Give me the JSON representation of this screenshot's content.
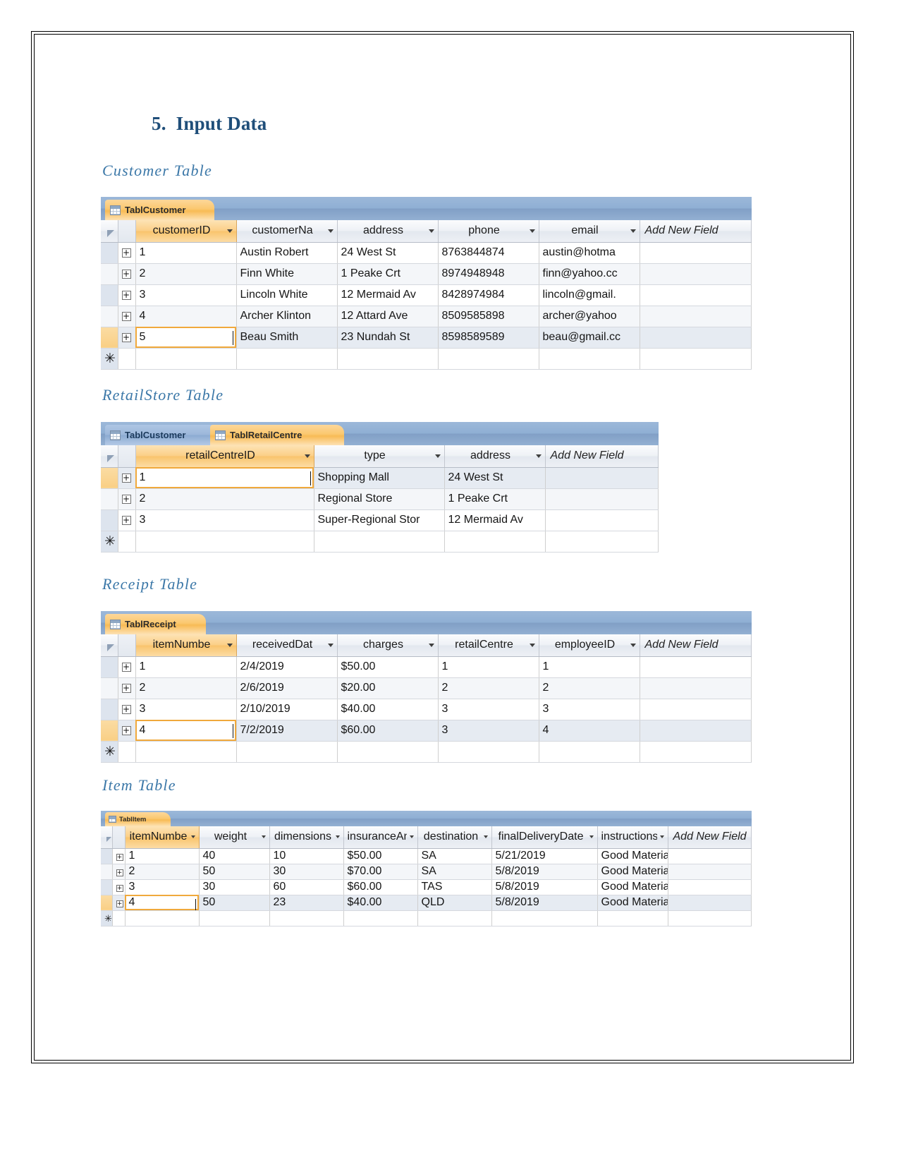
{
  "document": {
    "section_number": "5.",
    "section_title": "Input Data"
  },
  "sections": [
    {
      "key": "customer",
      "heading": "Customer Table"
    },
    {
      "key": "retailstore",
      "heading": "RetailStore Table"
    },
    {
      "key": "receipt",
      "heading": "Receipt Table"
    },
    {
      "key": "item",
      "heading": "Item Table"
    }
  ],
  "colors": {
    "heading": "#1f4e79",
    "subheading": "#3c78a8",
    "tab_active": "#f9c46d",
    "tab_inactive": "#9cb7da",
    "tabstrip": "#8fafd4",
    "selection_outline": "#f0a93c"
  },
  "add_new_field_label": "Add New Field",
  "new_record_marker": "✳",
  "expander_glyph": "+",
  "customer_table": {
    "tabs": [
      {
        "label": "TablCustomer",
        "active": true,
        "icon": "table-icon"
      }
    ],
    "columns": [
      "customerID",
      "customerNa",
      "address",
      "phone",
      "email"
    ],
    "active_column_index": 0,
    "rows": [
      {
        "cells": [
          "1",
          "Austin Robert",
          "24 West St",
          "8763844874",
          "austin@hotma"
        ]
      },
      {
        "cells": [
          "2",
          "Finn White",
          "1 Peake Crt",
          "8974948948",
          "finn@yahoo.cc"
        ]
      },
      {
        "cells": [
          "3",
          "Lincoln White",
          "12 Mermaid Av",
          "8428974984",
          "lincoln@gmail."
        ]
      },
      {
        "cells": [
          "4",
          "Archer Klinton",
          "12 Attard Ave",
          "8509585898",
          "archer@yahoo"
        ]
      },
      {
        "cells": [
          "5",
          "Beau Smith",
          "23 Nundah St",
          "8598589589",
          "beau@gmail.cc"
        ]
      }
    ],
    "selected_row_index": 4,
    "selected_cell_column": 0
  },
  "retailstore_table": {
    "tabs": [
      {
        "label": "TablCustomer",
        "active": false,
        "icon": "table-icon"
      },
      {
        "label": "TablRetailCentre",
        "active": true,
        "icon": "table-icon"
      }
    ],
    "columns": [
      "retailCentreID",
      "type",
      "address"
    ],
    "active_column_index": 0,
    "rows": [
      {
        "cells": [
          "1",
          "Shopping Mall",
          "24 West St"
        ]
      },
      {
        "cells": [
          "2",
          "Regional Store",
          "1 Peake Crt"
        ]
      },
      {
        "cells": [
          "3",
          "Super-Regional Stor",
          "12 Mermaid Av"
        ]
      }
    ],
    "selected_row_index": 0,
    "selected_cell_column": 0
  },
  "receipt_table": {
    "tabs": [
      {
        "label": "TablReceipt",
        "active": true,
        "icon": "table-icon"
      }
    ],
    "columns": [
      "itemNumbe",
      "receivedDat",
      "charges",
      "retailCentre",
      "employeeID"
    ],
    "active_column_index": 0,
    "rows": [
      {
        "cells": [
          "1",
          "2/4/2019",
          "$50.00",
          "1",
          "1"
        ]
      },
      {
        "cells": [
          "2",
          "2/6/2019",
          "$20.00",
          "2",
          "2"
        ]
      },
      {
        "cells": [
          "3",
          "2/10/2019",
          "$40.00",
          "3",
          "3"
        ]
      },
      {
        "cells": [
          "4",
          "7/2/2019",
          "$60.00",
          "3",
          "4"
        ]
      }
    ],
    "selected_row_index": 3,
    "selected_cell_column": 0
  },
  "item_table": {
    "tabs": [
      {
        "label": "Tablltem",
        "active": true,
        "icon": "table-icon"
      }
    ],
    "columns": [
      "itemNumbe",
      "weight",
      "dimensions",
      "insuranceAn",
      "destination",
      "finalDeliveryDate",
      "instructions"
    ],
    "active_column_index": 0,
    "rows": [
      {
        "cells": [
          "1",
          "40",
          "10",
          "$50.00",
          "SA",
          "5/21/2019",
          "Good Material"
        ]
      },
      {
        "cells": [
          "2",
          "50",
          "30",
          "$70.00",
          "SA",
          "5/8/2019",
          "Good Material"
        ]
      },
      {
        "cells": [
          "3",
          "30",
          "60",
          "$60.00",
          "TAS",
          "5/8/2019",
          "Good Material"
        ]
      },
      {
        "cells": [
          "4",
          "50",
          "23",
          "$40.00",
          "QLD",
          "5/8/2019",
          "Good Material"
        ]
      }
    ],
    "selected_row_index": 3,
    "selected_cell_column": 0
  }
}
